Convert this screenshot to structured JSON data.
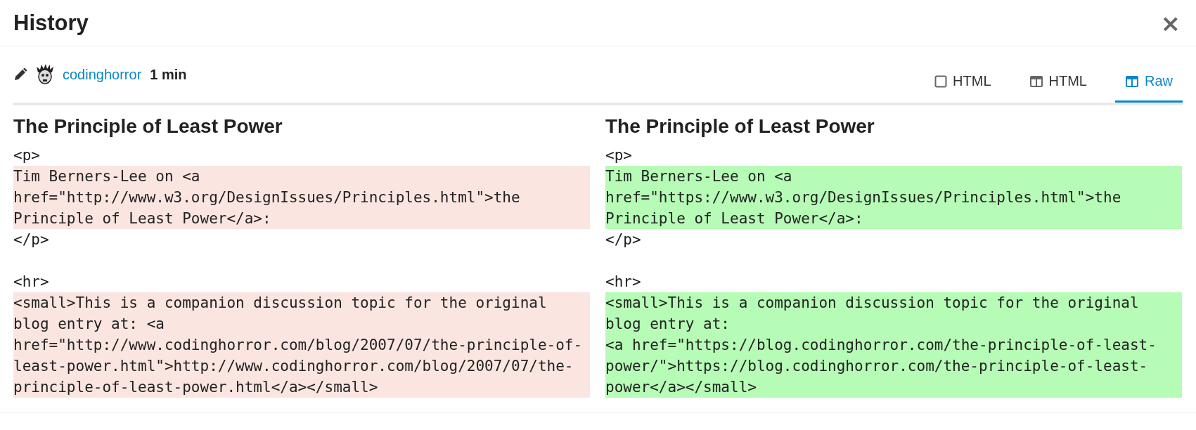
{
  "window": {
    "title": "History",
    "close": "×"
  },
  "revision": {
    "author": "codinghorror",
    "age": "1 min"
  },
  "tabs": [
    {
      "label": "HTML",
      "kind": "inline",
      "selected": false
    },
    {
      "label": "HTML",
      "kind": "split",
      "selected": false
    },
    {
      "label": "Raw",
      "kind": "split",
      "selected": true
    }
  ],
  "panes": [
    {
      "heading": "The Principle of Least Power",
      "blocks": [
        {
          "kind": "context",
          "lines": [
            "<p>"
          ]
        },
        {
          "kind": "removed",
          "lines": [
            "Tim Berners-Lee on <a",
            "href=\"http://www.w3.org/DesignIssues/Principles.html\">the",
            "Principle of Least Power</a>:"
          ]
        },
        {
          "kind": "context",
          "lines": [
            "</p>"
          ]
        },
        {
          "kind": "gap"
        },
        {
          "kind": "context",
          "lines": [
            "<hr>"
          ]
        },
        {
          "kind": "removed",
          "lines": [
            "<small>This is a companion discussion topic for the original",
            "blog entry at: <a",
            "href=\"http://www.codinghorror.com/blog/2007/07/the-principle-of-",
            "least-power.html\">http://www.codinghorror.com/blog/2007/07/the-",
            "principle-of-least-power.html</a></small>"
          ]
        }
      ]
    },
    {
      "heading": "The Principle of Least Power",
      "blocks": [
        {
          "kind": "context",
          "lines": [
            "<p>"
          ]
        },
        {
          "kind": "added",
          "lines": [
            "Tim Berners-Lee on <a",
            "href=\"https://www.w3.org/DesignIssues/Principles.html\">the",
            "Principle of Least Power</a>:"
          ]
        },
        {
          "kind": "context",
          "lines": [
            "</p>"
          ]
        },
        {
          "kind": "gap"
        },
        {
          "kind": "context",
          "lines": [
            "<hr>"
          ]
        },
        {
          "kind": "added",
          "lines": [
            "<small>This is a companion discussion topic for the original",
            "blog entry at:",
            "<a href=\"https://blog.codinghorror.com/the-principle-of-least-",
            "power/\">https://blog.codinghorror.com/the-principle-of-least-",
            "power</a></small>"
          ]
        }
      ]
    }
  ]
}
